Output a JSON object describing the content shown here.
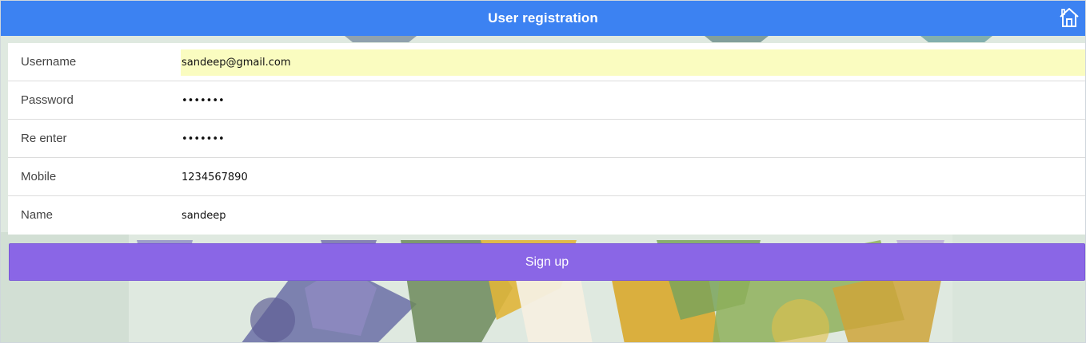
{
  "header": {
    "title": "User registration",
    "home_icon": "home-icon",
    "background_color": "#3c82f2"
  },
  "form": {
    "fields": [
      {
        "label": "Username",
        "value": "sandeep@gmail.com",
        "type": "text",
        "autofilled": true
      },
      {
        "label": "Password",
        "value": "sandeep",
        "type": "password",
        "autofilled": false
      },
      {
        "label": "Re enter",
        "value": "sandeep",
        "type": "password",
        "autofilled": false
      },
      {
        "label": "Mobile",
        "value": "1234567890",
        "type": "text",
        "autofilled": false
      },
      {
        "label": "Name",
        "value": "sandeep",
        "type": "text",
        "autofilled": false
      }
    ],
    "autofill_color": "#fafcc0"
  },
  "signup": {
    "label": "Sign up",
    "color": "#8a66e6"
  }
}
